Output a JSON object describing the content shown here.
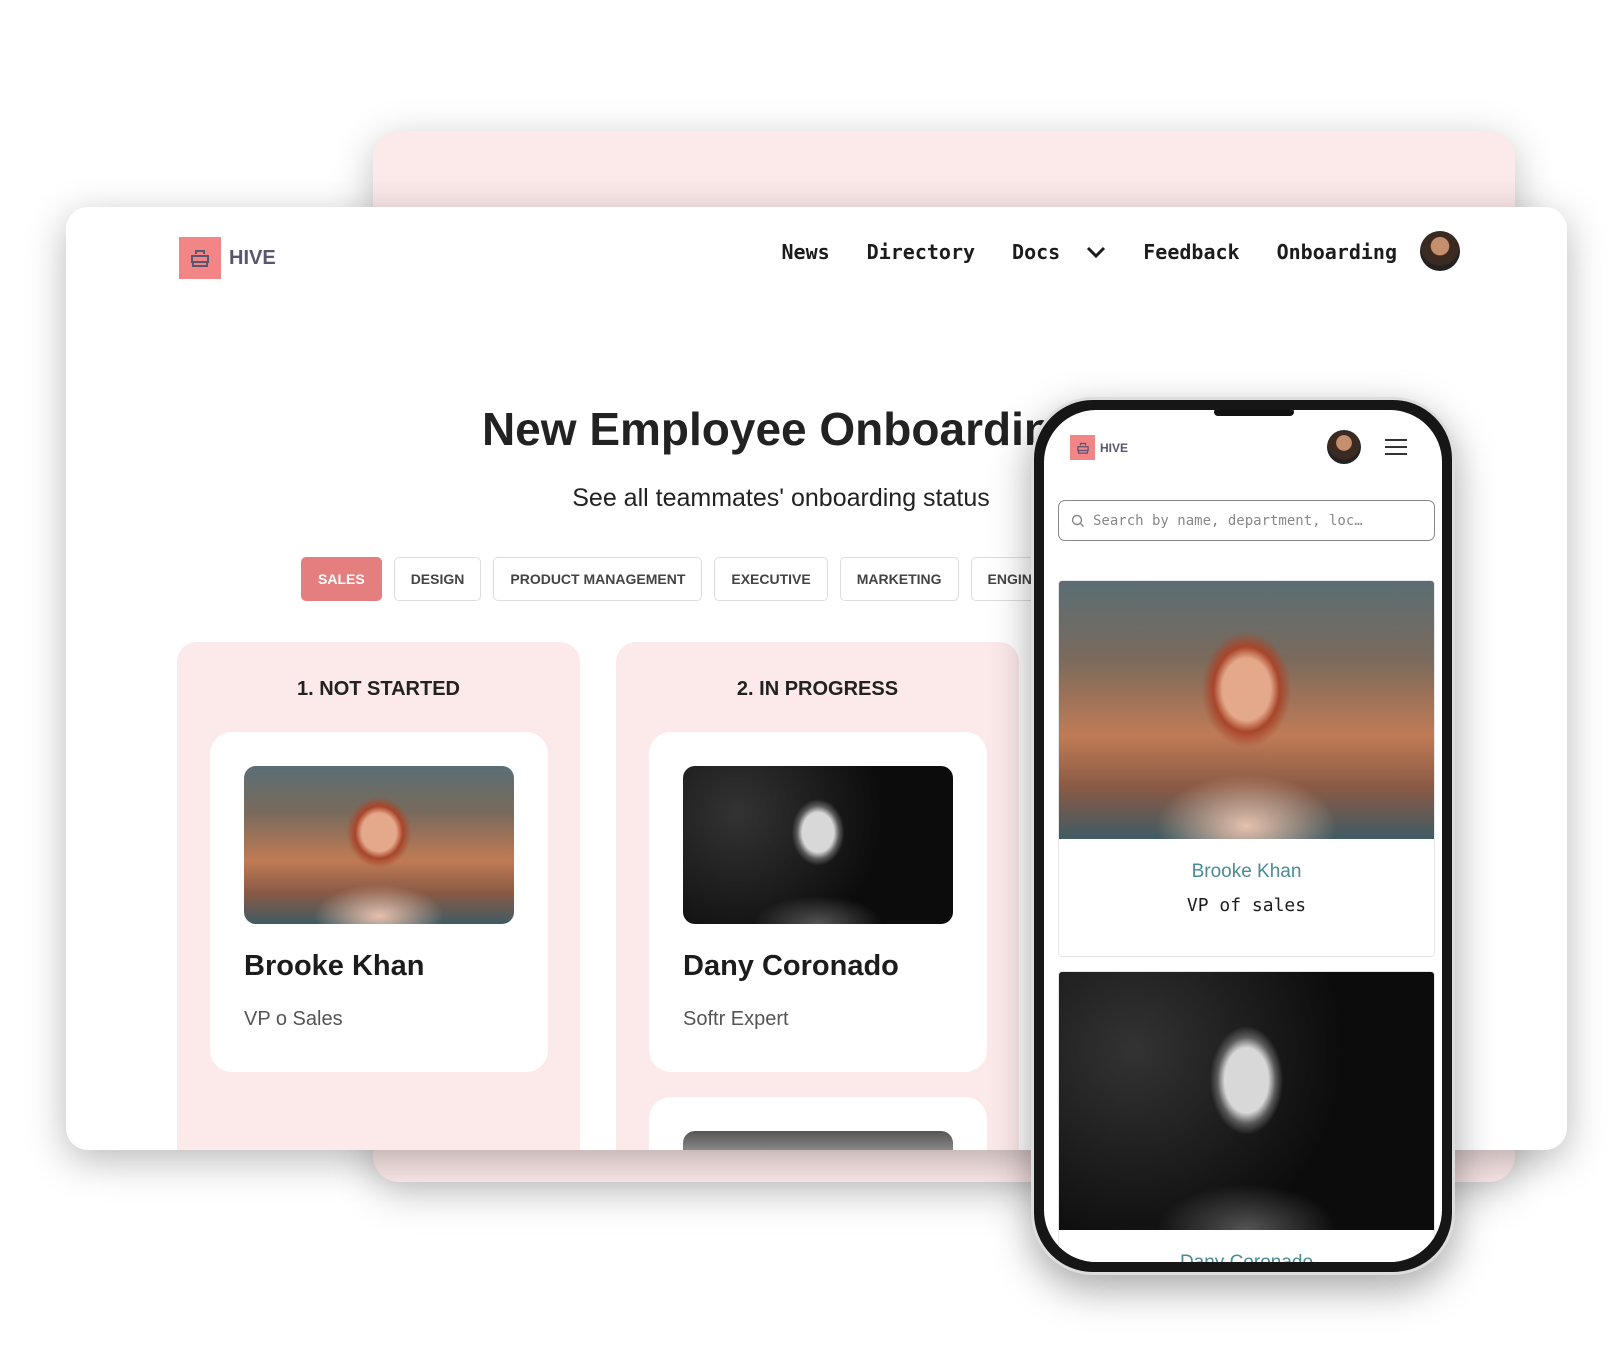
{
  "brand": {
    "name": "HIVE",
    "color": "#f28585",
    "icon": "briefcase-icon"
  },
  "nav": {
    "items": [
      "News",
      "Directory",
      "Docs",
      "Feedback",
      "Onboarding"
    ]
  },
  "page": {
    "title": "New Employee Onboarding",
    "subtitle": "See all teammates' onboarding status"
  },
  "tabs": [
    {
      "label": "SALES",
      "active": true
    },
    {
      "label": "DESIGN"
    },
    {
      "label": "PRODUCT MANAGEMENT"
    },
    {
      "label": "EXECUTIVE"
    },
    {
      "label": "MARKETING"
    },
    {
      "label": "ENGINEERING"
    }
  ],
  "columns": [
    {
      "title": "1. NOT STARTED",
      "cards": [
        {
          "name": "Brooke Khan",
          "role": "VP o Sales"
        }
      ]
    },
    {
      "title": "2. IN PROGRESS",
      "cards": [
        {
          "name": "Dany Coronado",
          "role": "Softr Expert"
        }
      ]
    }
  ],
  "mobile": {
    "search_placeholder": "Search by name, department, loc…",
    "cards": [
      {
        "name": "Brooke Khan",
        "role": "VP of sales"
      },
      {
        "name": "Dany Coronado"
      }
    ]
  },
  "colors": {
    "accent": "#e57f7f",
    "column_bg": "#fce9e9",
    "mobile_name": "#4b8b95"
  }
}
